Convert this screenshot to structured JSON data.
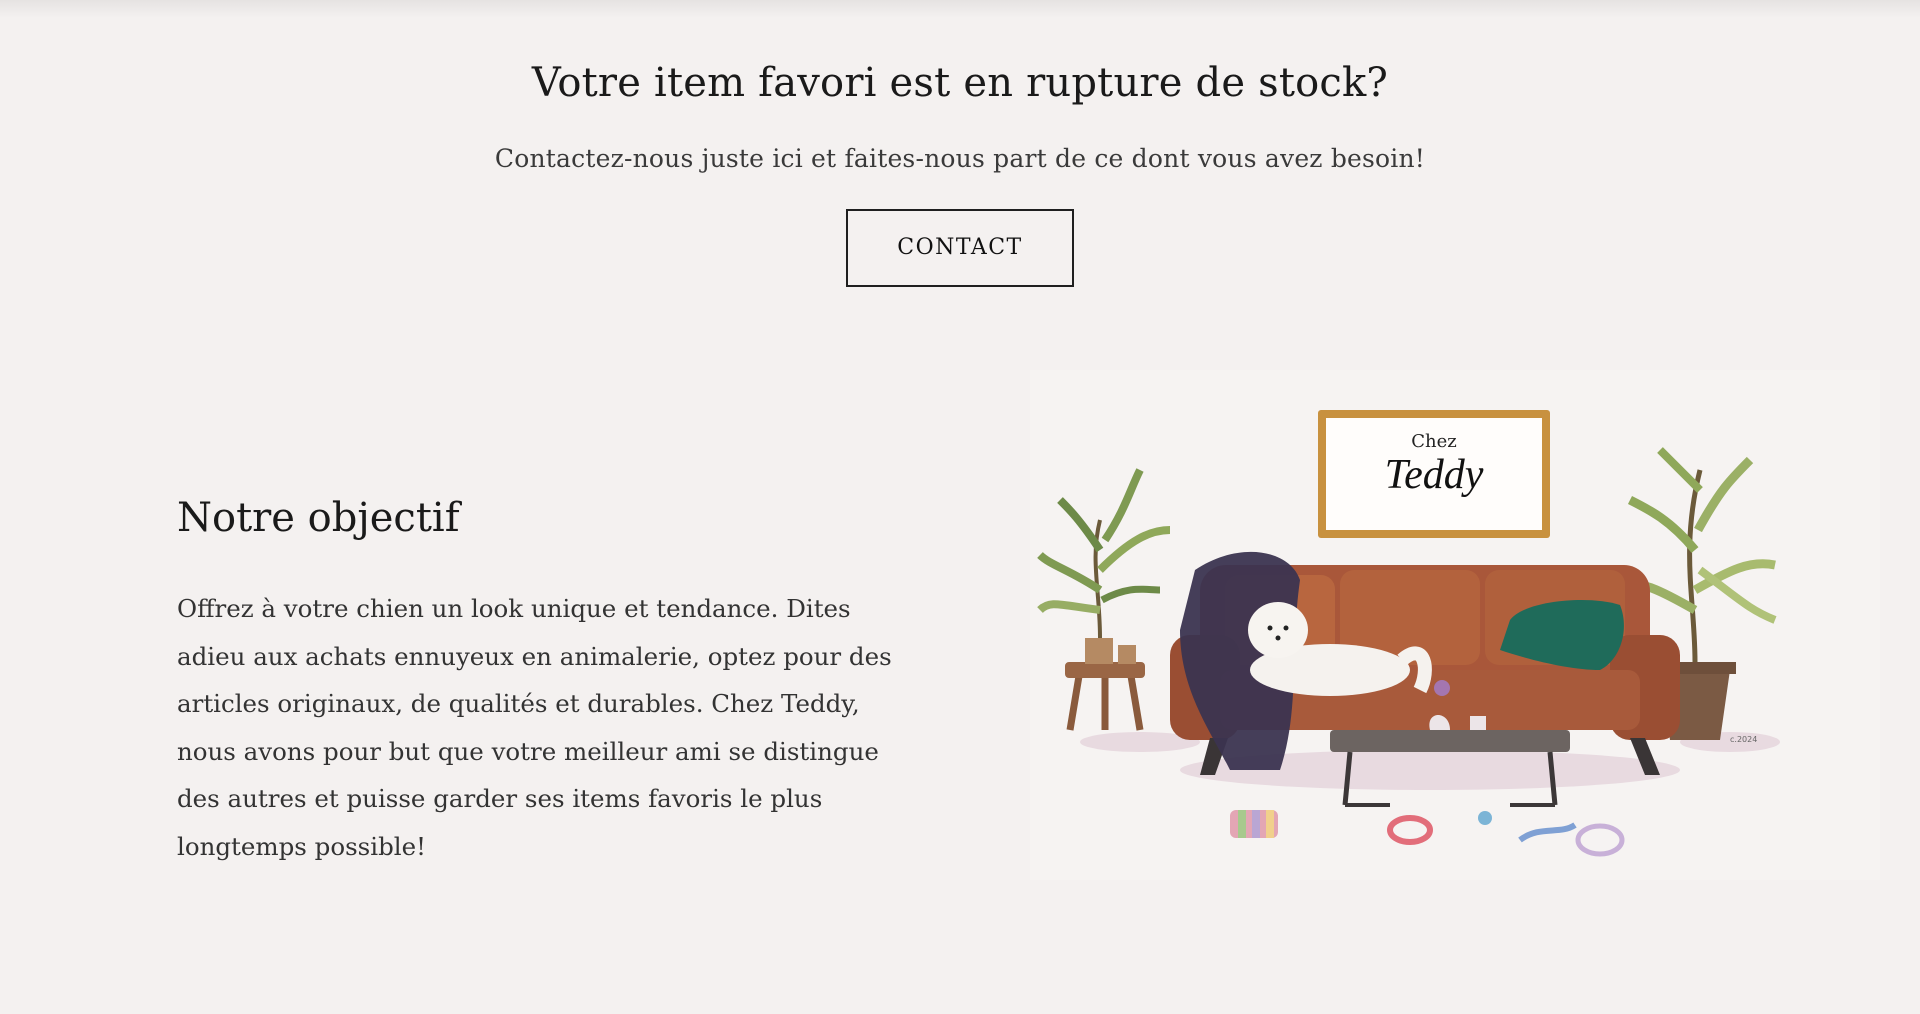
{
  "stock": {
    "title": "Votre item favori est en rupture de stock?",
    "subtitle": "Contactez-nous juste ici et faites-nous part de ce dont vous avez besoin!",
    "button_label": "CONTACT"
  },
  "objective": {
    "title": "Notre objectif",
    "body": "Offrez à votre chien un look unique et tendance. Dites adieu aux achats ennuyeux en animalerie, optez pour des articles originaux, de qualités et durables. Chez Teddy, nous avons pour but que votre meilleur ami se distingue des autres et puisse garder ses items favoris le plus longtemps possible!"
  },
  "illustration": {
    "sign_line1": "Chez",
    "sign_line2": "Teddy"
  },
  "colors": {
    "background": "#f4f1f0",
    "sofa": "#a9573a",
    "pillow": "#1f6b5a",
    "blanket": "#3b3450",
    "frame": "#c8913f"
  }
}
